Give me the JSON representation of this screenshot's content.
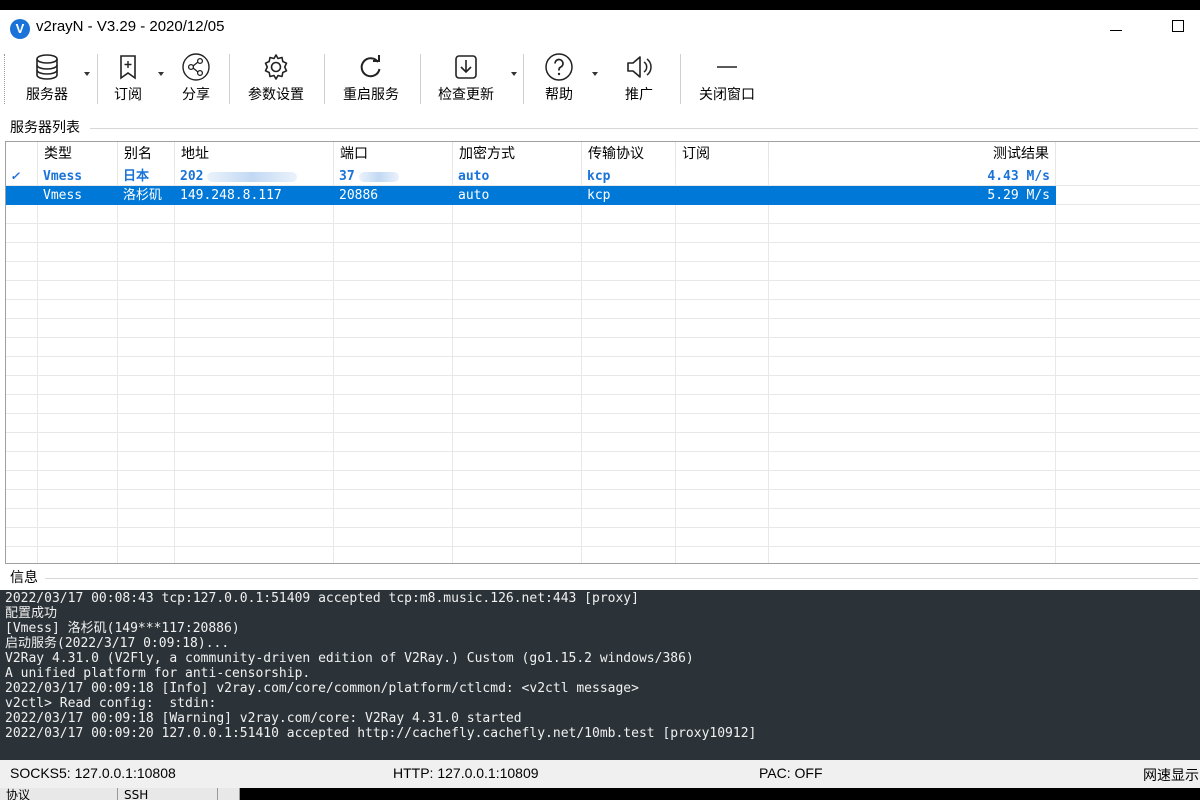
{
  "window": {
    "app_icon_letter": "V",
    "title": "v2rayN - V3.29 - 2020/12/05"
  },
  "toolbar": {
    "servers": "服务器",
    "subscribe": "订阅",
    "share": "分享",
    "settings": "参数设置",
    "restart": "重启服务",
    "check_update": "检查更新",
    "help": "帮助",
    "promote": "推广",
    "close_window": "关闭窗口"
  },
  "server_list": {
    "label": "服务器列表",
    "columns": [
      "类型",
      "别名",
      "地址",
      "端口",
      "加密方式",
      "传输协议",
      "订阅",
      "测试结果"
    ],
    "rows": [
      {
        "active": true,
        "mark": "✓",
        "type": "Vmess",
        "alias": "日本",
        "address": "202",
        "port": "37",
        "security": "auto",
        "network": "kcp",
        "subscription": "",
        "test_result": "4.43 M/s"
      },
      {
        "active": false,
        "mark": "",
        "type": "Vmess",
        "alias": "洛杉矶",
        "address": "149.248.8.117",
        "port": "20886",
        "security": "auto",
        "network": "kcp",
        "subscription": "",
        "test_result": "5.29 M/s"
      }
    ]
  },
  "info": {
    "label": "信息",
    "lines": [
      "2022/03/17 00:08:43 tcp:127.0.0.1:51409 accepted tcp:m8.music.126.net:443 [proxy]",
      "配置成功",
      "[Vmess] 洛杉矶(149***117:20886)",
      "启动服务(2022/3/17 0:09:18)...",
      "V2Ray 4.31.0 (V2Fly, a community-driven edition of V2Ray.) Custom (go1.15.2 windows/386)",
      "A unified platform for anti-censorship.",
      "2022/03/17 00:09:18 [Info] v2ray.com/core/common/platform/ctlcmd: <v2ctl message>",
      "v2ctl> Read config:  stdin:",
      "2022/03/17 00:09:18 [Warning] v2ray.com/core: V2Ray 4.31.0 started",
      "2022/03/17 00:09:20 127.0.0.1:51410 accepted http://cachefly.cachefly.net/10mb.test [proxy10912]"
    ]
  },
  "status": {
    "socks": "SOCKS5:  127.0.0.1:10808",
    "http": "HTTP:  127.0.0.1:10809",
    "pac": "PAC:  OFF",
    "speed": "网速显示"
  },
  "bottom_tabs": [
    "协议",
    "SSH"
  ],
  "colors": {
    "accent": "#1a73d8",
    "selection": "#0078d7",
    "log_bg": "#2b3338"
  }
}
